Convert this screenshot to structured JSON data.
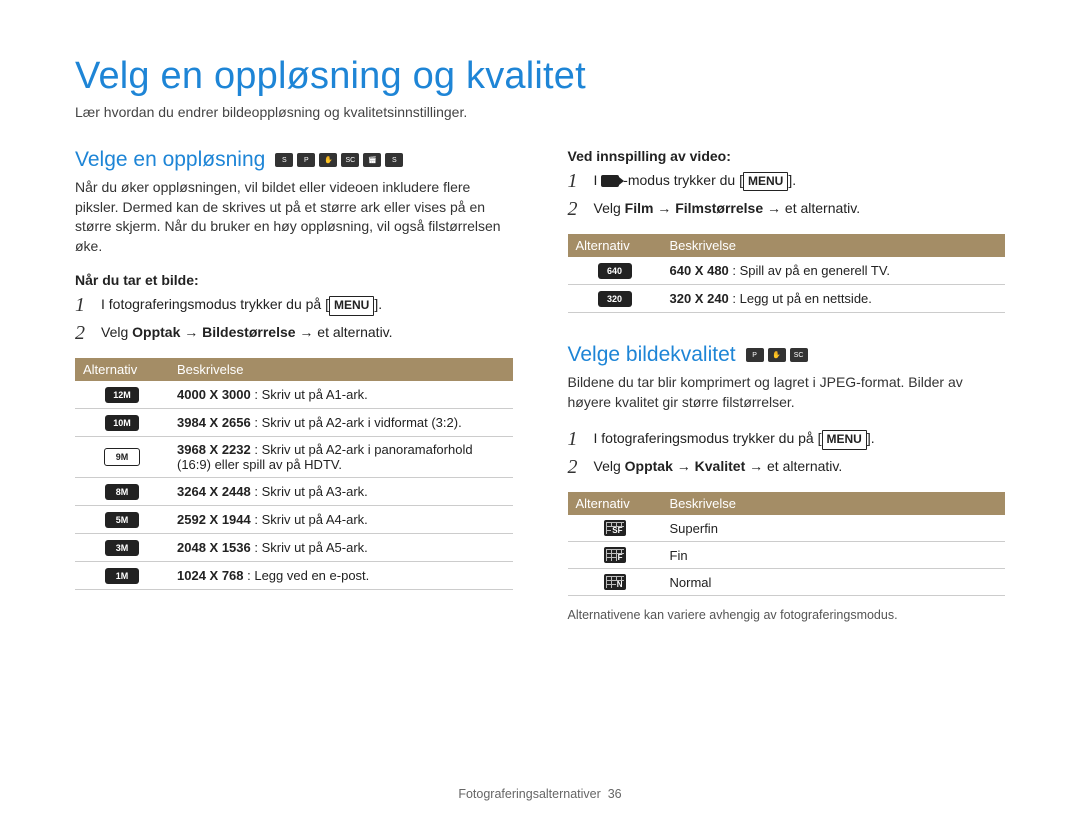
{
  "title": "Velg en oppløsning og kvalitet",
  "subtitle": "Lær hvordan du endrer bildeoppløsning og kvalitetsinnstillinger.",
  "menu_label": "MENU",
  "left": {
    "heading": "Velge en oppløsning",
    "intro": "Når du øker oppløsningen, vil bildet eller videoen inkludere flere piksler. Dermed kan de skrives ut på et større ark eller vises på en større skjerm. Når du bruker en høy oppløsning, vil også filstørrelsen øke.",
    "photo_label": "Når du tar et bilde:",
    "step1_pre": "I fotograferingsmodus trykker du på [",
    "step1_post": "].",
    "step2": "Velg Opptak → Bildestørrelse → et alternativ.",
    "table_headers": {
      "alt": "Alternativ",
      "desc": "Beskrivelse"
    },
    "rows": [
      {
        "icon": "12M",
        "bold": "4000 X 3000",
        "rest": " : Skriv ut på A1-ark."
      },
      {
        "icon": "10M",
        "bold": "3984 X 2656",
        "rest": " : Skriv ut på A2-ark i vidformat (3:2)."
      },
      {
        "icon": "9M",
        "bold": "3968 X 2232",
        "rest": " : Skriv ut på A2-ark i panoramaforhold (16:9) eller spill av på HDTV."
      },
      {
        "icon": "8M",
        "bold": "3264 X 2448",
        "rest": " : Skriv ut på A3-ark."
      },
      {
        "icon": "5M",
        "bold": "2592 X 1944",
        "rest": " : Skriv ut på A4-ark."
      },
      {
        "icon": "3M",
        "bold": "2048 X 1536",
        "rest": " : Skriv ut på A5-ark."
      },
      {
        "icon": "1M",
        "bold": "1024 X 768",
        "rest": " : Legg ved en e-post."
      }
    ]
  },
  "right": {
    "video_label": "Ved innspilling av video:",
    "vstep1_pre": "I ",
    "vstep1_mid": " -modus trykker du [",
    "vstep1_post": "].",
    "vstep2": "Velg Film → Filmstørrelse → et alternativ.",
    "vtable_headers": {
      "alt": "Alternativ",
      "desc": "Beskrivelse"
    },
    "vrows": [
      {
        "icon": "640",
        "bold": "640 X 480",
        "rest": " : Spill av på en generell TV."
      },
      {
        "icon": "320",
        "bold": "320 X 240",
        "rest": " : Legg ut på en nettside."
      }
    ],
    "quality_heading": "Velge bildekvalitet",
    "quality_intro": "Bildene du tar blir komprimert og lagret i JPEG-format. Bilder av høyere kvalitet gir større filstørrelser.",
    "qstep1_pre": "I fotograferingsmodus trykker du på [",
    "qstep1_post": "].",
    "qstep2": "Velg Opptak → Kvalitet → et alternativ.",
    "qtable_headers": {
      "alt": "Alternativ",
      "desc": "Beskrivelse"
    },
    "qrows": [
      {
        "sub": "SF",
        "label": "Superfin"
      },
      {
        "sub": "F",
        "label": "Fin"
      },
      {
        "sub": "N",
        "label": "Normal"
      }
    ],
    "footnote": "Alternativene kan variere avhengig av fotograferingsmodus."
  },
  "footer": {
    "text": "Fotograferingsalternativer",
    "page": "36"
  }
}
